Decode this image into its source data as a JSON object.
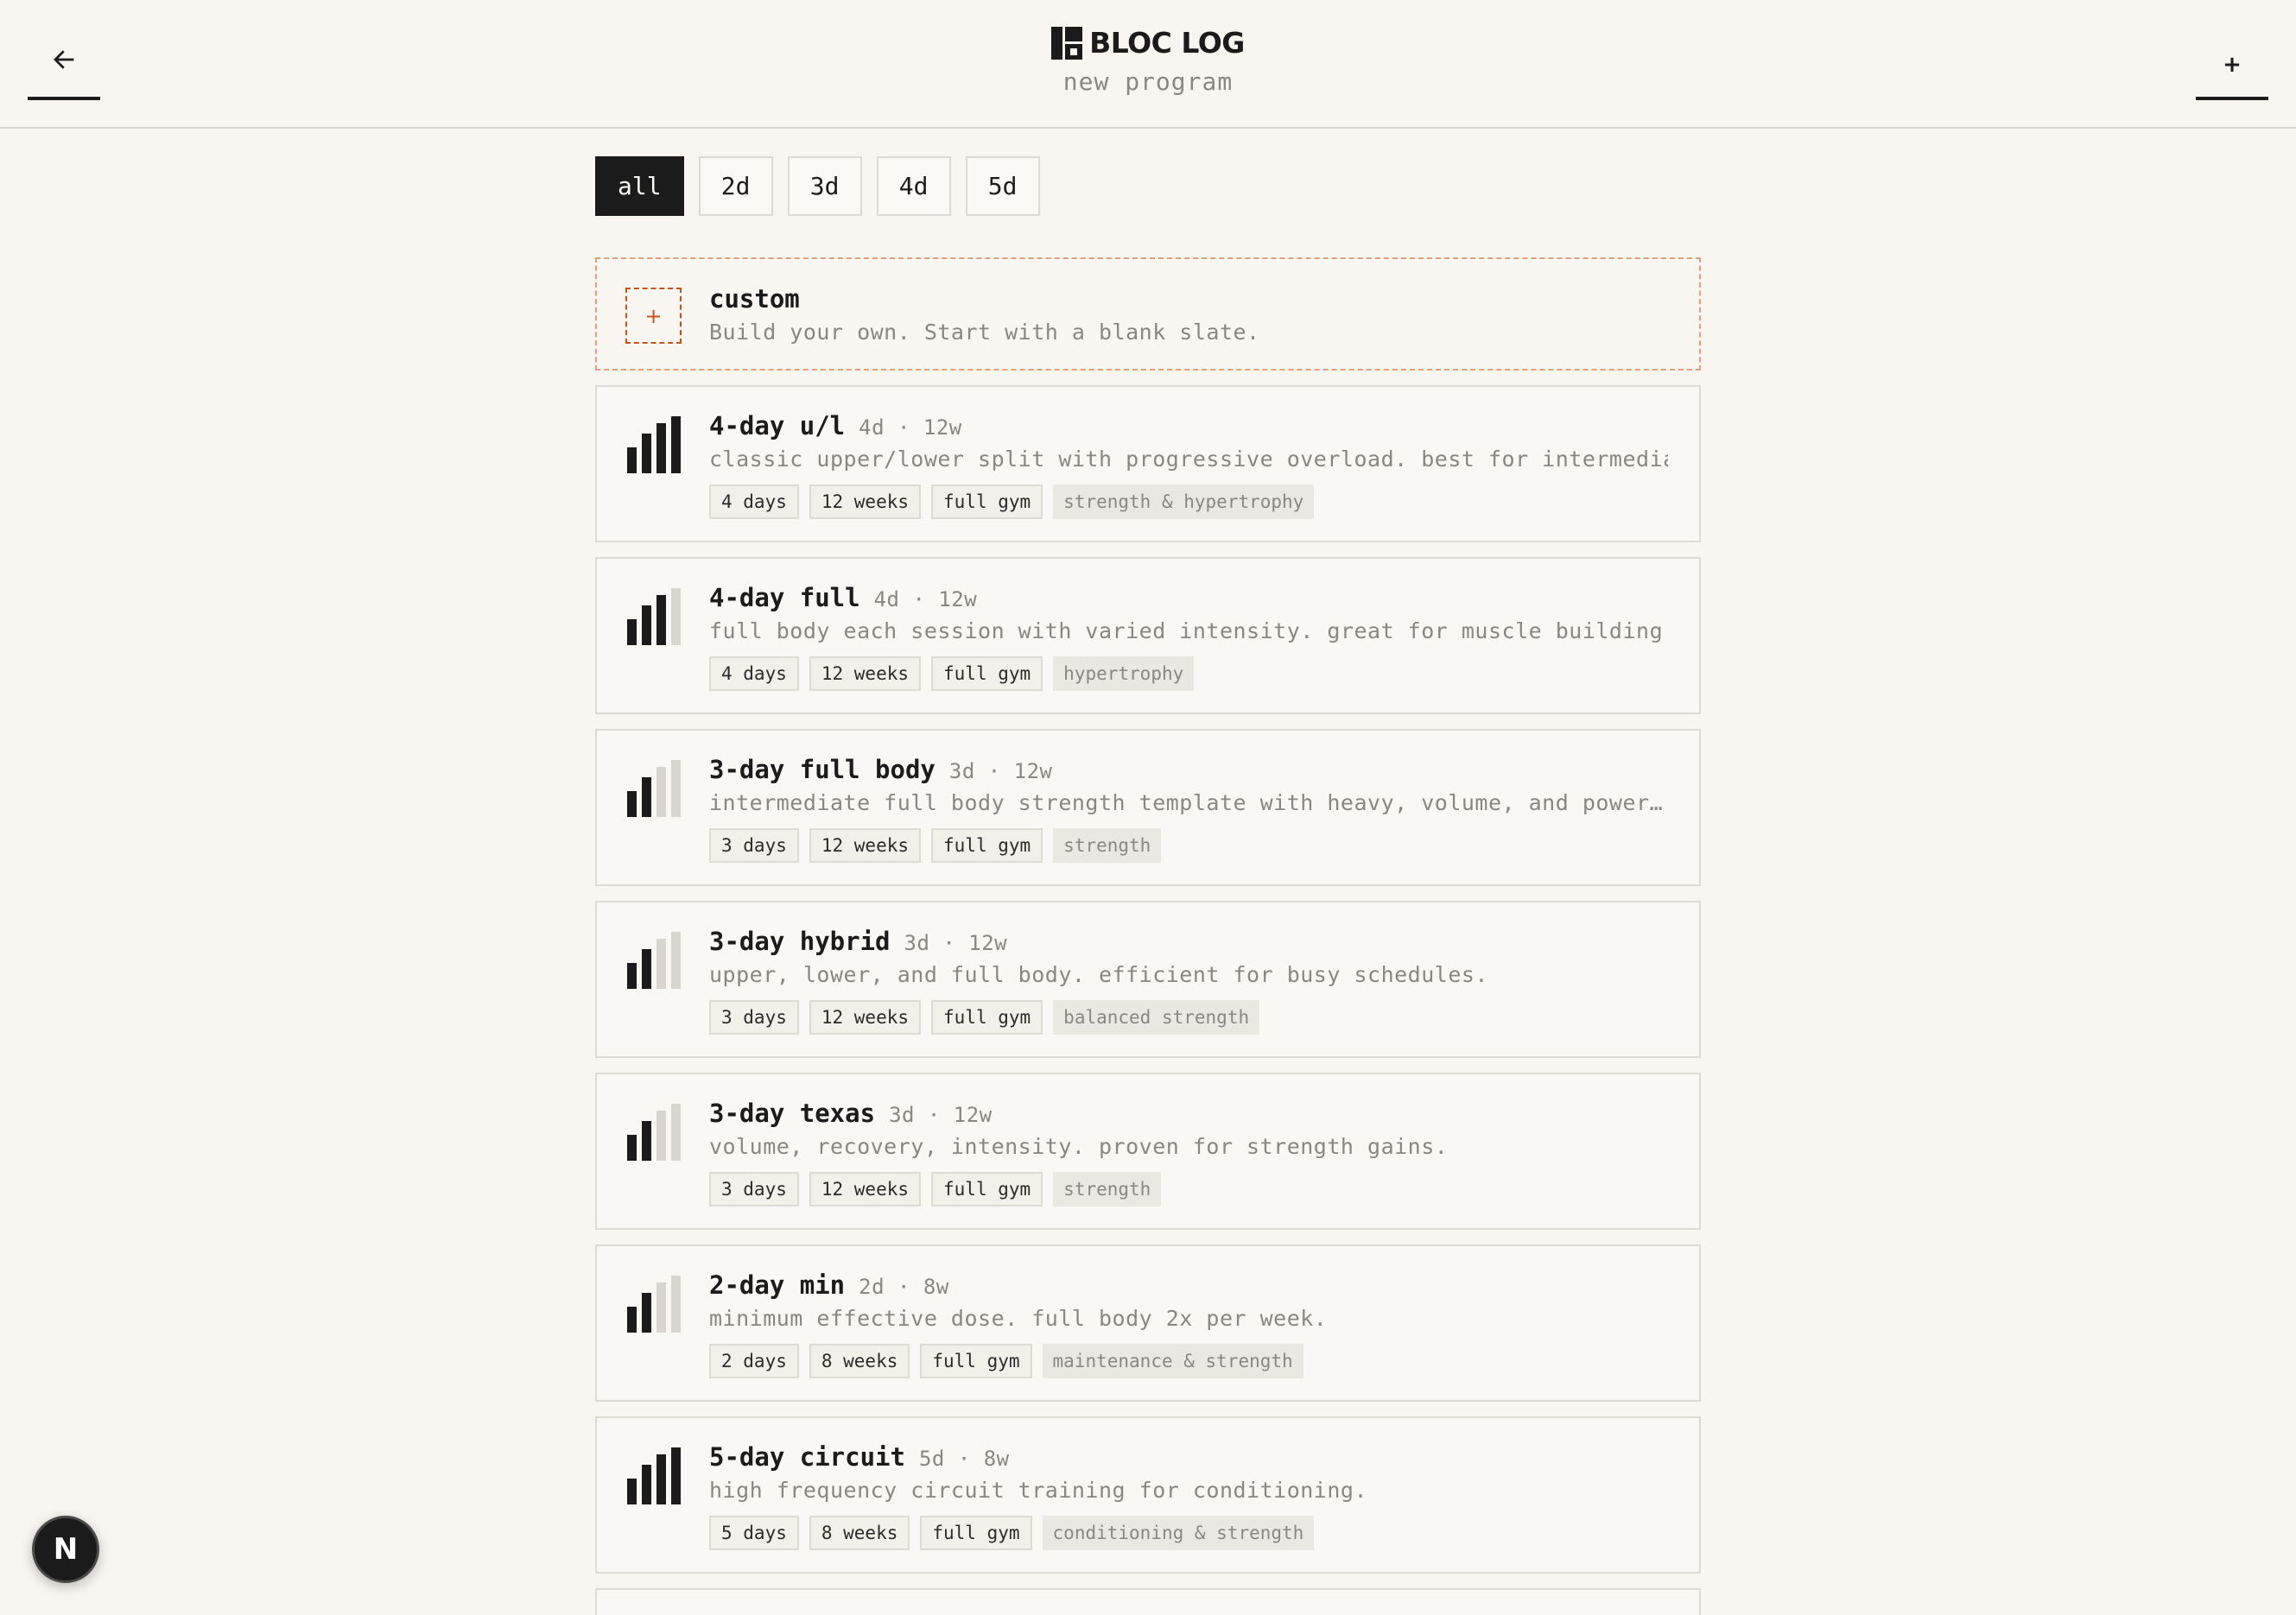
{
  "header": {
    "brand": "BLOC LOG",
    "subtitle": "new program",
    "back_icon": "arrow-left-icon",
    "add_label": "+"
  },
  "filters": [
    "all",
    "2d",
    "3d",
    "4d",
    "5d"
  ],
  "active_filter": "all",
  "custom": {
    "plus": "+",
    "title": "custom",
    "description": "Build your own. Start with a blank slate."
  },
  "programs": [
    {
      "name": "4-day u/l",
      "meta": "4d · 12w",
      "intensity": 4,
      "description": "classic upper/lower split with progressive overload. best for intermediate…",
      "tags": [
        "4 days",
        "12 weeks",
        "full gym"
      ],
      "goal": "strength & hypertrophy"
    },
    {
      "name": "4-day full",
      "meta": "4d · 12w",
      "intensity": 3,
      "description": "full body each session with varied intensity. great for muscle building.",
      "tags": [
        "4 days",
        "12 weeks",
        "full gym"
      ],
      "goal": "hypertrophy"
    },
    {
      "name": "3-day full body",
      "meta": "3d · 12w",
      "intensity": 2,
      "description": "intermediate full body strength template with heavy, volume, and power…",
      "tags": [
        "3 days",
        "12 weeks",
        "full gym"
      ],
      "goal": "strength"
    },
    {
      "name": "3-day hybrid",
      "meta": "3d · 12w",
      "intensity": 2,
      "description": "upper, lower, and full body. efficient for busy schedules.",
      "tags": [
        "3 days",
        "12 weeks",
        "full gym"
      ],
      "goal": "balanced strength"
    },
    {
      "name": "3-day texas",
      "meta": "3d · 12w",
      "intensity": 2,
      "description": "volume, recovery, intensity. proven for strength gains.",
      "tags": [
        "3 days",
        "12 weeks",
        "full gym"
      ],
      "goal": "strength"
    },
    {
      "name": "2-day min",
      "meta": "2d · 8w",
      "intensity": 2,
      "description": "minimum effective dose. full body 2x per week.",
      "tags": [
        "2 days",
        "8 weeks",
        "full gym"
      ],
      "goal": "maintenance & strength"
    },
    {
      "name": "5-day circuit",
      "meta": "5d · 8w",
      "intensity": 4,
      "description": "high frequency circuit training for conditioning.",
      "tags": [
        "5 days",
        "8 weeks",
        "full gym"
      ],
      "goal": "conditioning & strength"
    }
  ],
  "colors": {
    "bar_active": "#1b1b1b",
    "bar_inactive": "#d9d6d0",
    "accent": "#c8531b"
  },
  "dev_badge": "N"
}
